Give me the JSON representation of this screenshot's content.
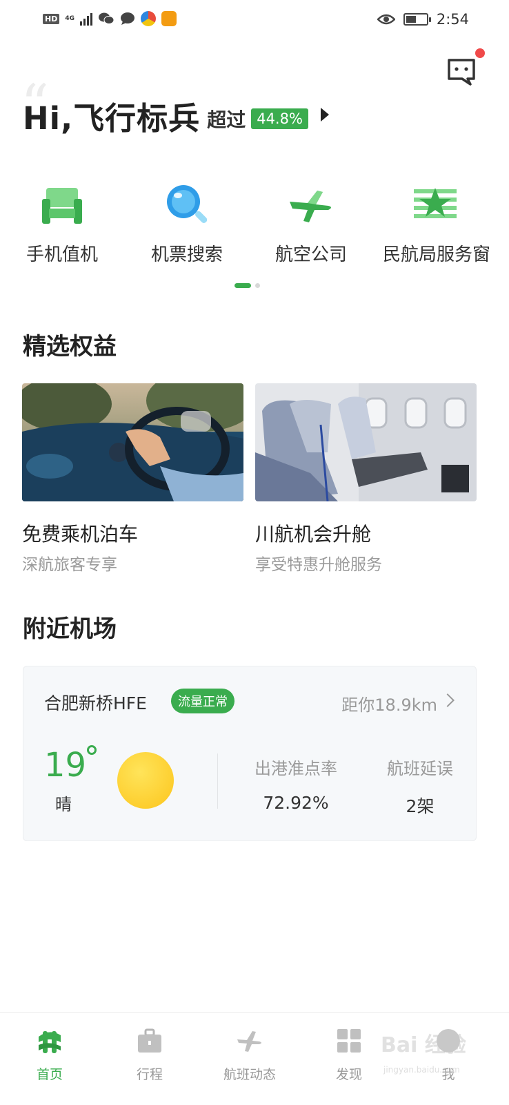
{
  "status_bar": {
    "hd": "HD",
    "network": "4G",
    "time": "2:54"
  },
  "greeting": {
    "title": "Hi,飞行标兵",
    "exceed_label": "超过",
    "percent": "44.8%"
  },
  "services": [
    {
      "label": "手机值机",
      "icon": "seat-icon"
    },
    {
      "label": "机票搜索",
      "icon": "search-icon"
    },
    {
      "label": "航空公司",
      "icon": "airplane-icon"
    },
    {
      "label": "民航局服务窗",
      "icon": "star-flag-icon"
    }
  ],
  "pager": {
    "pages": 2,
    "current": 1
  },
  "benefits": {
    "title": "精选权益",
    "items": [
      {
        "title": "免费乘机泊车",
        "subtitle": "深航旅客专享",
        "image": "car-driving-photo"
      },
      {
        "title": "川航机会升舱",
        "subtitle": "享受特惠升舱服务",
        "image": "airplane-seat-photo"
      }
    ]
  },
  "nearby": {
    "title": "附近机场",
    "airport_name": "合肥新桥HFE",
    "traffic_status": "流量正常",
    "distance": "距你18.9km",
    "temperature": "19",
    "weather": "晴",
    "weather_icon": "sun-icon",
    "stats": [
      {
        "label": "出港准点率",
        "value": "72.92%"
      },
      {
        "label": "航班延误",
        "value": "2架"
      }
    ]
  },
  "tabbar": {
    "items": [
      {
        "label": "首页",
        "icon": "home-icon",
        "active": true
      },
      {
        "label": "行程",
        "icon": "briefcase-icon",
        "active": false
      },
      {
        "label": "航班动态",
        "icon": "plane-icon",
        "active": false
      },
      {
        "label": "发现",
        "icon": "grid-icon",
        "active": false
      },
      {
        "label": "我",
        "icon": "user-icon",
        "active": false
      }
    ]
  },
  "watermark": {
    "text": "Bai 经验",
    "sub": "jingyan.baidu.com"
  },
  "colors": {
    "accent": "#3aac4e",
    "notification": "#f04a4a",
    "sun": "#fcc51c"
  }
}
